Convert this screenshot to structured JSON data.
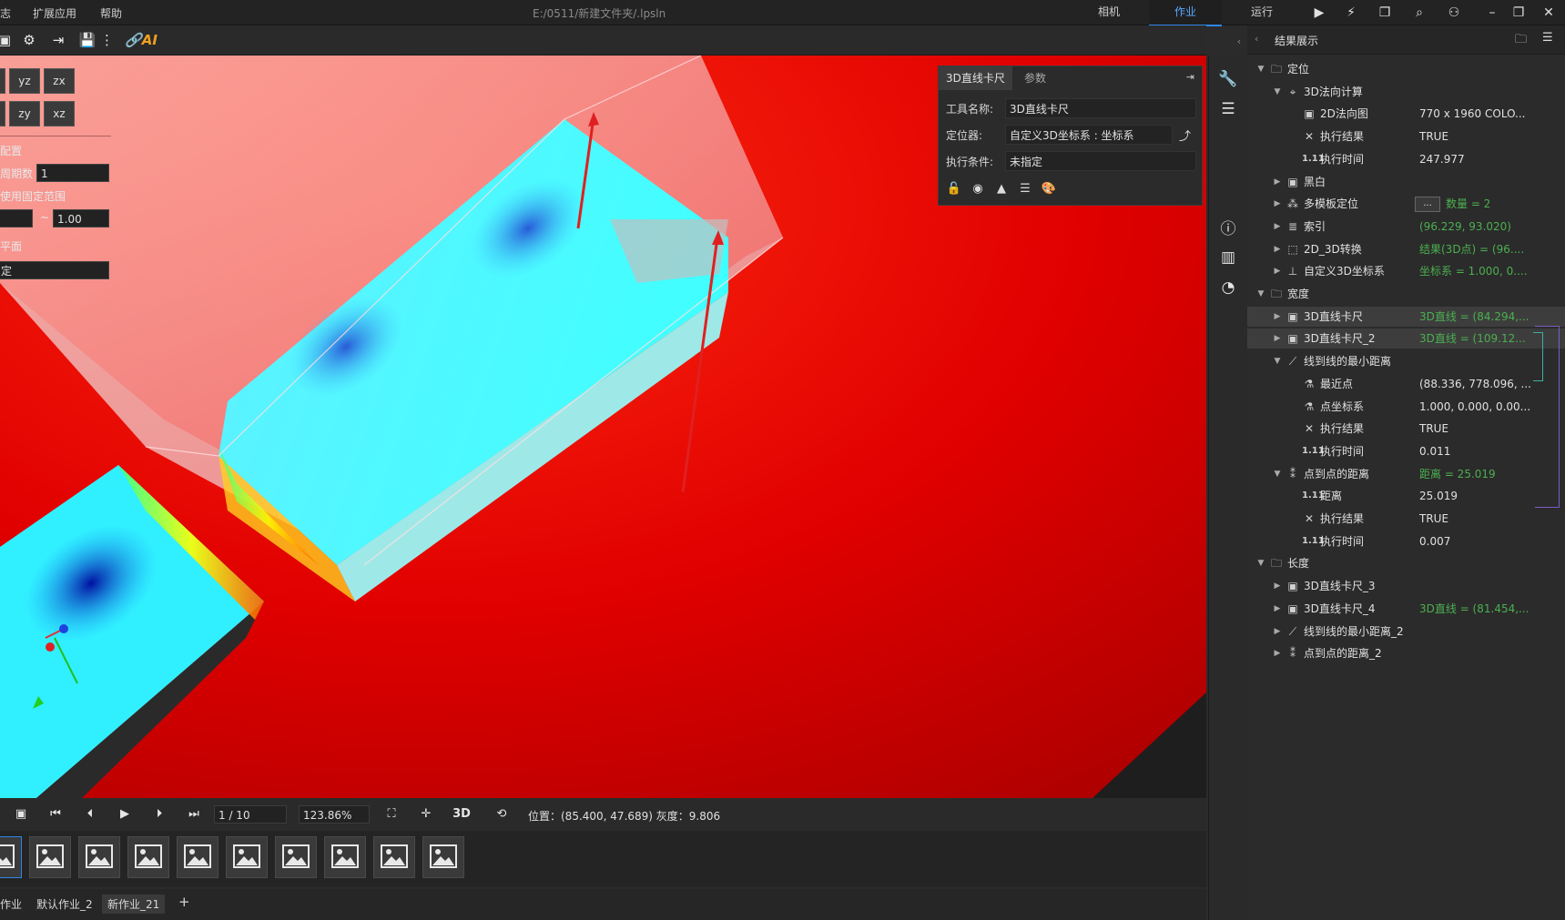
{
  "menu": {
    "item0": "志",
    "item1": "扩展应用",
    "item2": "帮助"
  },
  "file_path": "E:/0511/新建文件夹/.lpsln",
  "mode_tabs": {
    "camera": "相机",
    "job": "作业",
    "run": "运行"
  },
  "toolbar": {
    "ai_label": "AI"
  },
  "left_panel": {
    "btn_yz": "yz",
    "btn_zx": "zx",
    "btn_zy": "zy",
    "btn_xz": "xz",
    "config_label": "配置",
    "period_label": "周期数",
    "period_value": "1",
    "fixed_range_label": "使用固定范围",
    "range_max": "1.00",
    "range_sep": "~",
    "plane_label": "平面",
    "plane_value": "定"
  },
  "tool_dialog": {
    "tab_tool": "3D直线卡尺",
    "tab_params": "参数",
    "name_label": "工具名称:",
    "name_value": "3D直线卡尺",
    "locator_label": "定位器:",
    "locator_value": "自定义3D坐标系 : 坐标系",
    "cond_label": "执行条件:",
    "cond_value": "未指定"
  },
  "results": {
    "title": "结果展示",
    "rows": [
      {
        "label": "定位",
        "value": ""
      },
      {
        "label": "3D法向计算",
        "value": ""
      },
      {
        "label": "2D法向图",
        "value": "770 x 1960 COLO..."
      },
      {
        "label": "执行结果",
        "value": "TRUE"
      },
      {
        "label": "执行时间",
        "value": "247.977"
      },
      {
        "label": "黑白",
        "value": ""
      },
      {
        "label": "多模板定位",
        "value": "数量 = 2"
      },
      {
        "label": "索引",
        "value": "(96.229, 93.020)"
      },
      {
        "label": "2D_3D转换",
        "value": "结果(3D点) = (96...."
      },
      {
        "label": "自定义3D坐标系",
        "value": "坐标系 = 1.000, 0...."
      },
      {
        "label": "宽度",
        "value": ""
      },
      {
        "label": "3D直线卡尺",
        "value": "3D直线 = (84.294,..."
      },
      {
        "label": "3D直线卡尺_2",
        "value": "3D直线 = (109.12..."
      },
      {
        "label": "线到线的最小距离",
        "value": ""
      },
      {
        "label": "最近点",
        "value": "(88.336, 778.096, ..."
      },
      {
        "label": "点坐标系",
        "value": "1.000, 0.000, 0.00..."
      },
      {
        "label": "执行结果",
        "value": "TRUE"
      },
      {
        "label": "执行时间",
        "value": "0.011"
      },
      {
        "label": "点到点的距离",
        "value": "距离 = 25.019"
      },
      {
        "label": "距离",
        "value": "25.019"
      },
      {
        "label": "执行结果",
        "value": "TRUE"
      },
      {
        "label": "执行时间",
        "value": "0.007"
      },
      {
        "label": "长度",
        "value": ""
      },
      {
        "label": "3D直线卡尺_3",
        "value": ""
      },
      {
        "label": "3D直线卡尺_4",
        "value": "3D直线 = (81.454,..."
      },
      {
        "label": "线到线的最小距离_2",
        "value": ""
      },
      {
        "label": "点到点的距离_2",
        "value": ""
      }
    ],
    "time_prefix": "1.11",
    "more_button": "..."
  },
  "playback": {
    "frame": "1 / 10",
    "zoom": "123.86%",
    "mode_3d": "3D",
    "status": "位置：(85.400, 47.689) 灰度：9.806"
  },
  "job_tabs": {
    "tab0": "作业",
    "tab1": "默认作业_2",
    "tab2": "新作业_21",
    "add": "+"
  },
  "colors": {
    "accent": "#2f86e8",
    "green_value": "#4caf50",
    "red_bg": "#cc0000"
  }
}
